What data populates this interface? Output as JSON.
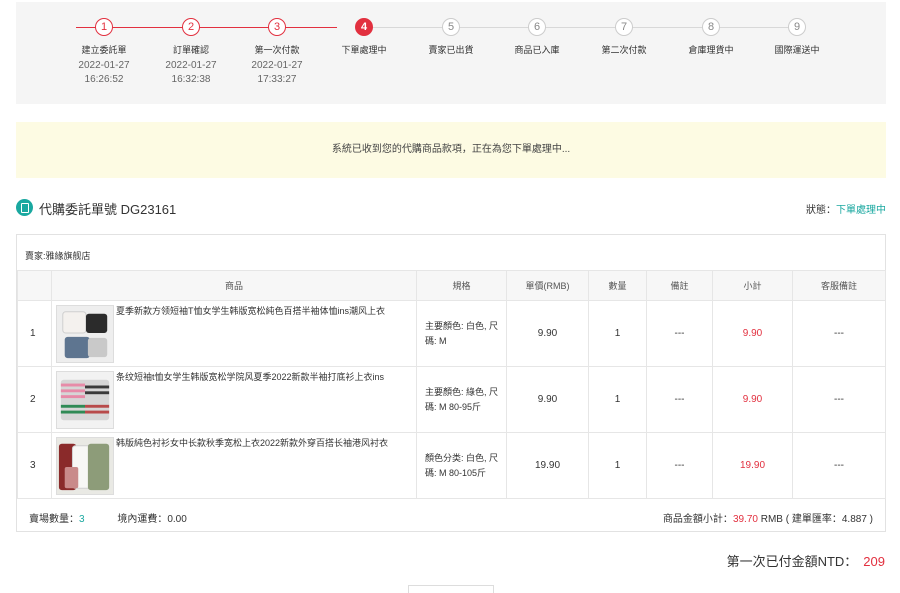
{
  "stepper": {
    "steps": [
      {
        "num": "1",
        "label": "建立委託單",
        "date": "2022-01-27",
        "time": "16:26:52",
        "state": "done"
      },
      {
        "num": "2",
        "label": "訂單確認",
        "date": "2022-01-27",
        "time": "16:32:38",
        "state": "done"
      },
      {
        "num": "3",
        "label": "第一次付款",
        "date": "2022-01-27",
        "time": "17:33:27",
        "state": "done"
      },
      {
        "num": "4",
        "label": "下單處理中",
        "date": "",
        "time": "",
        "state": "current"
      },
      {
        "num": "5",
        "label": "賣家已出貨",
        "date": "",
        "time": "",
        "state": "todo"
      },
      {
        "num": "6",
        "label": "商品已入庫",
        "date": "",
        "time": "",
        "state": "todo"
      },
      {
        "num": "7",
        "label": "第二次付款",
        "date": "",
        "time": "",
        "state": "todo"
      },
      {
        "num": "8",
        "label": "倉庫理貨中",
        "date": "",
        "time": "",
        "state": "todo"
      },
      {
        "num": "9",
        "label": "國際運送中",
        "date": "",
        "time": "",
        "state": "todo"
      }
    ]
  },
  "notice": "系統已收到您的代購商品款項，正在為您下單處理中...",
  "order": {
    "title": "代購委託單號 DG23161",
    "status_label": "狀態：",
    "status_value": "下單處理中"
  },
  "seller": "賣家:雅緣旗舰店",
  "table": {
    "headers": [
      "",
      "商品",
      "規格",
      "單價(RMB)",
      "數量",
      "備註",
      "小計",
      "客服備註"
    ],
    "rows": [
      {
        "idx": "1",
        "name": "夏季新款方领短袖T恤女学生韩版宽松純色百搭半袖体恤ins潮风上衣",
        "spec": "主要顏色: 白色, 尺碼: M",
        "price": "9.90",
        "qty": "1",
        "note": "---",
        "subtotal": "9.90",
        "cs_note": "---"
      },
      {
        "idx": "2",
        "name": "条纹短袖t恤女学生韩版宽松学院风夏季2022新款半袖打底衫上衣ins",
        "spec": "主要顏色: 綠色, 尺碼: M 80-95斤",
        "price": "9.90",
        "qty": "1",
        "note": "---",
        "subtotal": "9.90",
        "cs_note": "---"
      },
      {
        "idx": "3",
        "name": "韩版純色衬衫女中长款秋季宽松上衣2022新款外穿百搭长袖港风衬衣",
        "spec": "顏色分类: 白色, 尺碼: M 80-105斤",
        "price": "19.90",
        "qty": "1",
        "note": "---",
        "subtotal": "19.90",
        "cs_note": "---"
      }
    ]
  },
  "footer": {
    "count_label": "賣場數量：",
    "count_value": "3",
    "fee_text": "境內運費：0.00",
    "subtotal_label": "商品金額小計：",
    "subtotal_value": "39.70",
    "subtotal_rest": "RMB ( 建單匯率：4.887 )"
  },
  "paid": {
    "label": "第一次已付金額NTD：",
    "amount": "209"
  }
}
